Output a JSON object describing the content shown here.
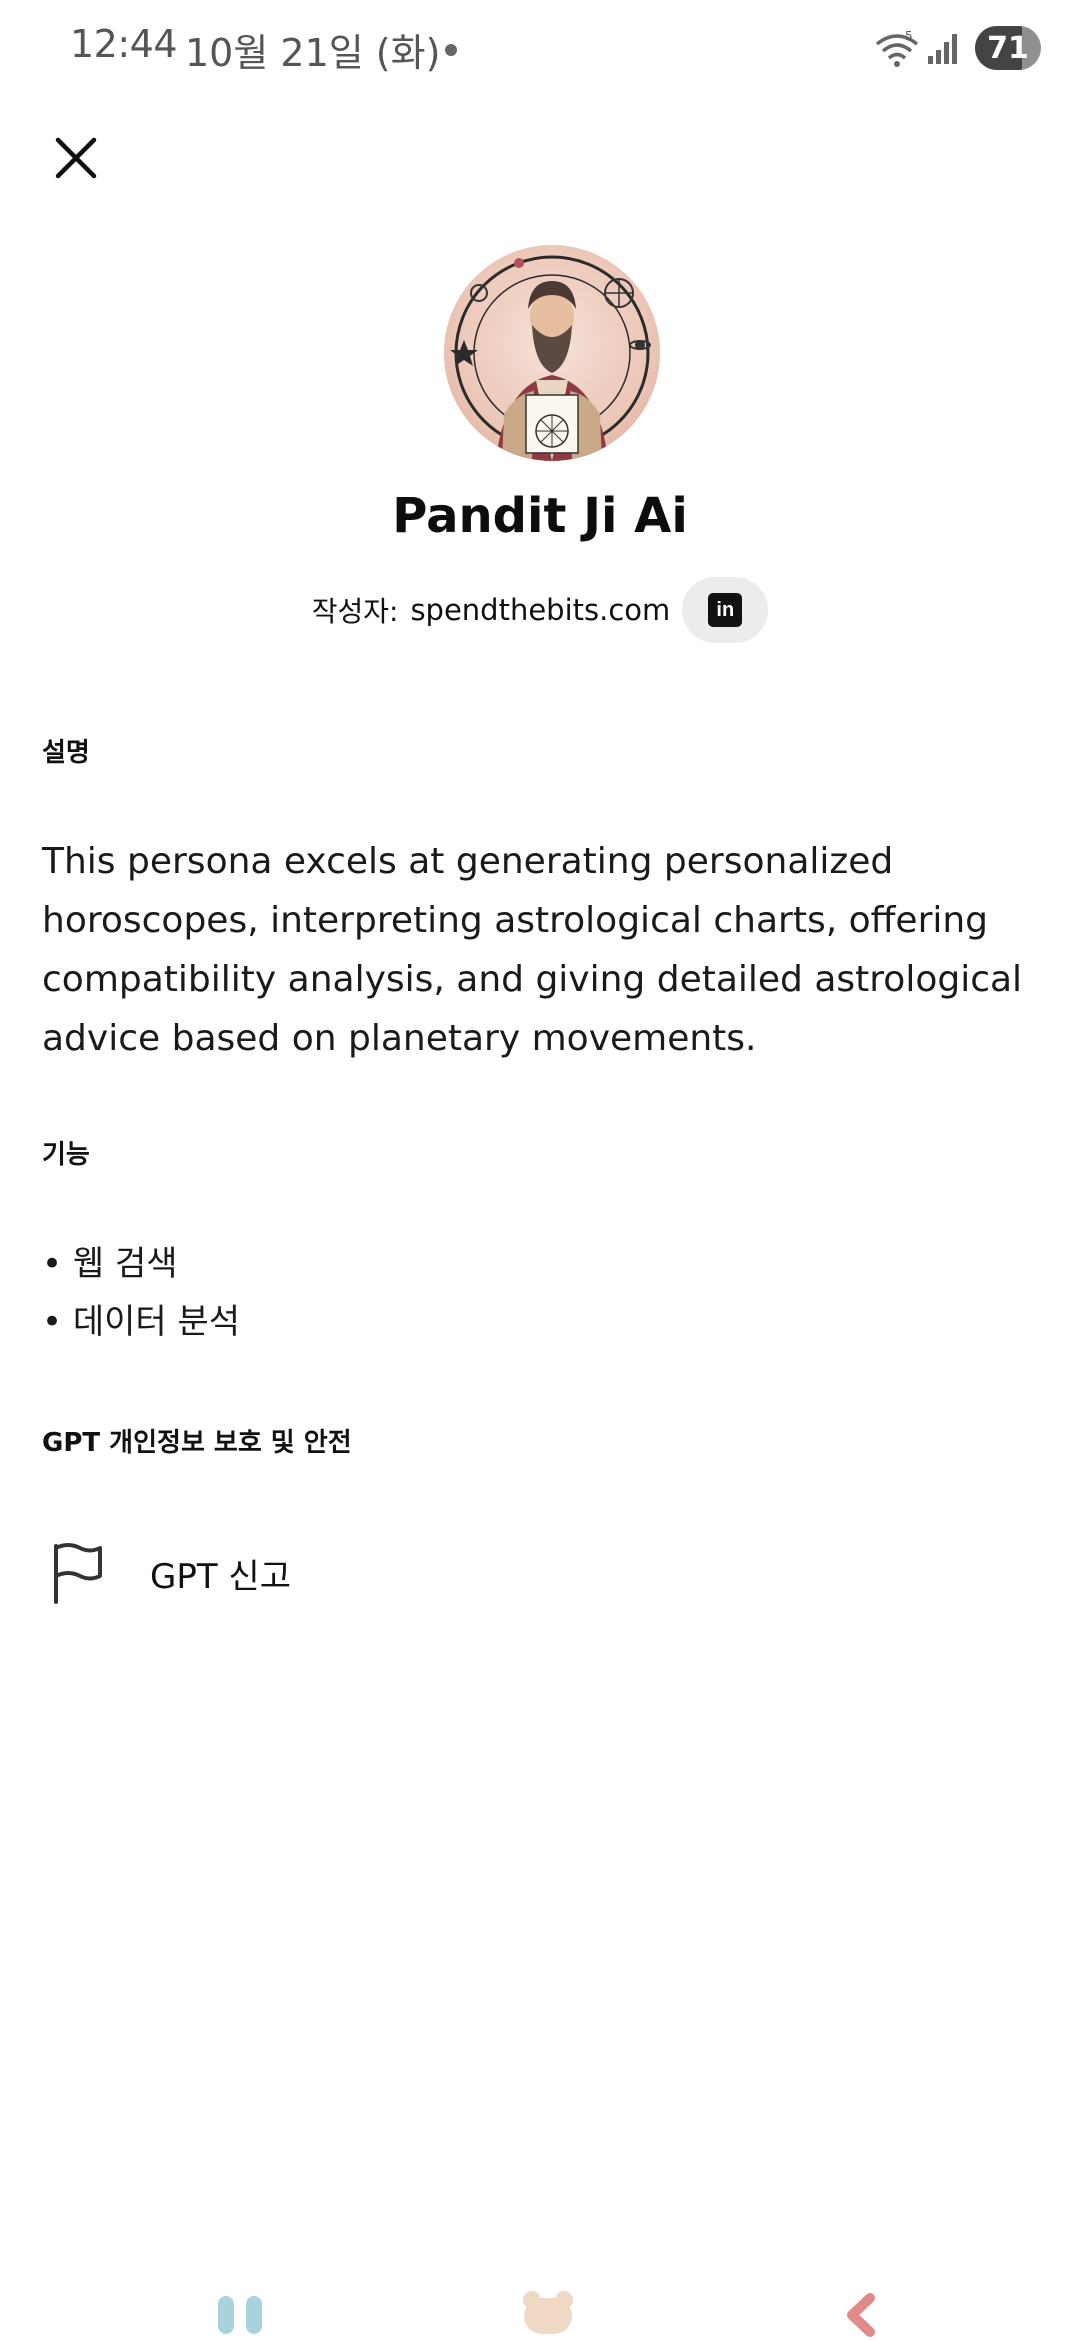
{
  "status_bar": {
    "time": "12:44",
    "date": "10월 21일 (화)",
    "battery": "71",
    "battery_level": 0.71,
    "wifi_badge": "5"
  },
  "header": {
    "close_icon": "close-icon"
  },
  "gpt": {
    "title": "Pandit Ji Ai",
    "author_label": "작성자:",
    "author_name": "spendthebits.com",
    "linkedin_label": "in"
  },
  "sections": {
    "description_heading": "설명",
    "description_text": "This persona excels at generating personalized horoscopes, interpreting astrological charts, offering compatibility analysis, and giving detailed astrological advice based on planetary movements.",
    "capabilities_heading": "기능",
    "capabilities": [
      "웹 검색",
      "데이터 분석"
    ],
    "privacy_heading": "GPT 개인정보 보호 및 안전"
  },
  "report": {
    "label": "GPT 신고",
    "icon": "flag-icon"
  },
  "nav": {
    "recent_icon": "recent-apps-icon",
    "home_icon": "home-icon",
    "back_icon": "back-icon"
  },
  "colors": {
    "nav_recent": "#a9d3dc",
    "nav_home": "#f0d9c4",
    "nav_back": "#e08a8a",
    "linkedin_bg": "#ececec"
  }
}
